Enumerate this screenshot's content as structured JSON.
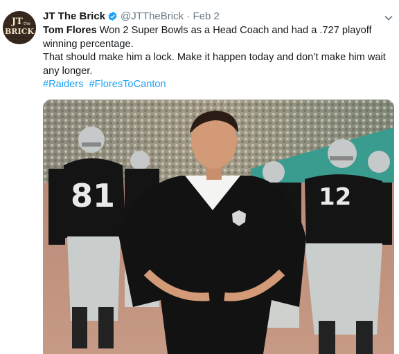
{
  "tweet": {
    "author_name": "JT The Brick",
    "handle": "@JTTheBrick",
    "separator": "·",
    "time": "Feb 2",
    "avatar_text_top": "JT",
    "avatar_text_mid": "the",
    "avatar_text_bottom": "BRICK",
    "body_line1_bold": "Tom Flores",
    "body_line1_rest": " Won 2 Super Bowls as a Head Coach and had a .727 playoff winning percentage.",
    "body_line2": "That should make him a lock. Make it happen today and don’t make him wait any longer.",
    "hashtags": [
      "#Raiders",
      "#FloresToCanton"
    ],
    "photo": {
      "jersey_left": "81",
      "jersey_right": "12"
    }
  },
  "icons": [
    "verified-badge-icon",
    "chevron-down-icon"
  ],
  "colors": {
    "link": "#1da1f2",
    "secondary_text": "#657786",
    "primary_text": "#14171a",
    "raiders_black": "#111111",
    "raiders_silver": "#c4c8c8"
  }
}
